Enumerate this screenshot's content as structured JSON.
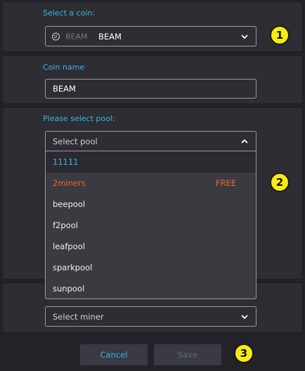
{
  "coin_section": {
    "label": "Select a coin:",
    "selected_ticker": "BEAM",
    "selected_name": "BEAM"
  },
  "name_section": {
    "label": "Coin name",
    "value": "BEAM"
  },
  "pool_section": {
    "label": "Please select pool:",
    "placeholder": "Select pool",
    "options": [
      {
        "label": "11111",
        "tag": ""
      },
      {
        "label": "2miners",
        "tag": "FREE"
      },
      {
        "label": "beepool",
        "tag": ""
      },
      {
        "label": "f2pool",
        "tag": ""
      },
      {
        "label": "leafpool",
        "tag": ""
      },
      {
        "label": "sparkpool",
        "tag": ""
      },
      {
        "label": "sunpool",
        "tag": ""
      }
    ]
  },
  "miner_section": {
    "placeholder": "Select miner"
  },
  "footer": {
    "cancel_label": "Cancel",
    "save_label": "Save"
  },
  "badges": {
    "one": "1",
    "two": "2",
    "three": "3"
  },
  "colors": {
    "accent": "#39b5e6",
    "free": "#e9662c",
    "badge": "#f6ea17"
  }
}
